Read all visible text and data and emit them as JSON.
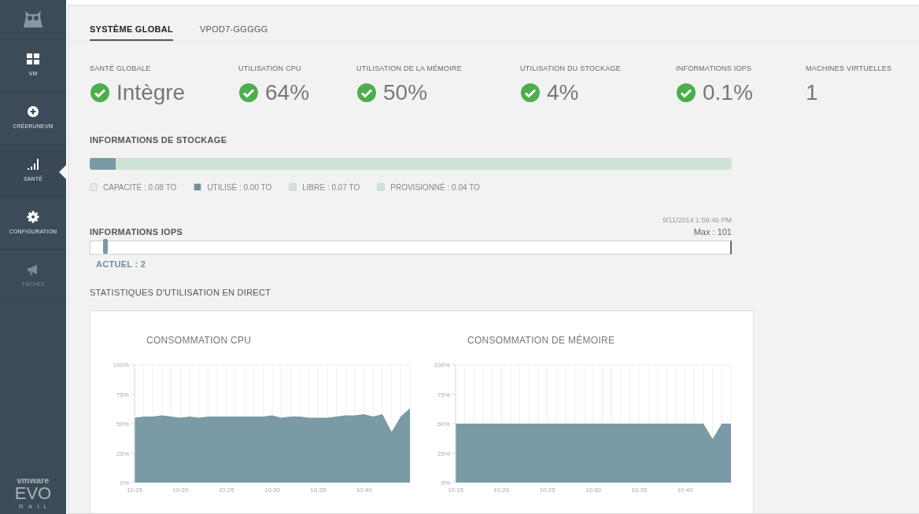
{
  "sidebar": {
    "items": [
      {
        "label": "VM",
        "selected": false,
        "disabled": false
      },
      {
        "label": "CRÉERUNEVM",
        "selected": false,
        "disabled": false
      },
      {
        "label": "SANTÉ",
        "selected": true,
        "disabled": false
      },
      {
        "label": "CONFIGURATION",
        "selected": false,
        "disabled": false
      },
      {
        "label": "TÂCHES",
        "selected": false,
        "disabled": true
      }
    ],
    "logo": {
      "brand": "vmware",
      "product": "EVO",
      "edition": "RAIL"
    }
  },
  "tabs": [
    {
      "label": "SYSTÈME GLOBAL",
      "selected": true
    },
    {
      "label": "VPOD7-GGGGG",
      "selected": false
    }
  ],
  "metrics": [
    {
      "label": "SANTÉ GLOBALE",
      "value": "Intègre",
      "kind": "status"
    },
    {
      "label": "UTILISATION CPU",
      "value": "64%",
      "kind": "status"
    },
    {
      "label": "UTILISATION DE LA MÉMOIRE",
      "value": "50%",
      "kind": "status"
    },
    {
      "label": "UTILISATION DU STOCKAGE",
      "value": "4%",
      "kind": "status"
    },
    {
      "label": "INFORMATIONS IOPS",
      "value": "0.1%",
      "kind": "status"
    },
    {
      "label": "MACHINES VIRTUELLES",
      "value": "1",
      "kind": "count"
    }
  ],
  "storage": {
    "title": "INFORMATIONS DE STOCKAGE",
    "level": 0.04,
    "legend": [
      {
        "label": "CAPACITÉ : 0.08 TO",
        "color": "#e8e8e8"
      },
      {
        "label": "UTILISÉ : 0.00 TO",
        "color": "#6f8f9c"
      },
      {
        "label": "LIBRE : 0.07 TO",
        "color": "#cfe4d6"
      },
      {
        "label": "PROVISIONNÉ : 0.04 TO",
        "color": "#cfe4d6"
      }
    ]
  },
  "iops": {
    "title": "INFORMATIONS IOPS",
    "timestamp": "9/11/2014 1:59:46 PM",
    "max": "Max : 101",
    "current": "ACTUEL : 2",
    "level": 0.02
  },
  "live_stats": {
    "title": "STATISTIQUES D'UTILISATION EN DIRECT",
    "charts": [
      {
        "chart_data": {
          "type": "area",
          "title": "CONSOMMATION CPU",
          "grid": true,
          "categories": [
            "10:15",
            null,
            null,
            null,
            null,
            "10:20",
            null,
            null,
            null,
            null,
            "10:25",
            null,
            null,
            null,
            null,
            "10:30",
            null,
            null,
            null,
            null,
            "10:35",
            null,
            null,
            null,
            null,
            "10:40",
            null,
            null,
            null,
            null,
            null
          ],
          "ylim": [
            0,
            100
          ],
          "yticks": [
            {
              "value": 0,
              "label": "0%"
            },
            {
              "value": 25,
              "label": "25%"
            },
            {
              "value": 50,
              "label": "50%"
            },
            {
              "value": 75,
              "label": "75%"
            },
            {
              "value": 100,
              "label": "100%"
            }
          ],
          "series": [
            {
              "color": "#7a9aa5",
              "values": [
                55,
                56,
                56,
                57,
                56,
                55,
                56,
                55,
                56,
                56,
                56,
                56,
                56,
                56,
                56,
                57,
                55,
                56,
                56,
                55,
                55,
                55,
                56,
                57,
                57,
                58,
                56,
                58,
                43,
                56,
                63
              ]
            }
          ]
        }
      },
      {
        "chart_data": {
          "type": "area",
          "title": "CONSOMMATION DE MÉMOIRE",
          "grid": true,
          "categories": [
            "10:15",
            null,
            null,
            null,
            null,
            "10:20",
            null,
            null,
            null,
            null,
            "10:25",
            null,
            null,
            null,
            null,
            "10:30",
            null,
            null,
            null,
            null,
            "10:35",
            null,
            null,
            null,
            null,
            "10:40",
            null,
            null,
            null,
            null,
            null
          ],
          "ylim": [
            0,
            100
          ],
          "yticks": [
            {
              "value": 0,
              "label": "0%"
            },
            {
              "value": 25,
              "label": "25%"
            },
            {
              "value": 50,
              "label": "50%"
            },
            {
              "value": 75,
              "label": "75%"
            },
            {
              "value": 100,
              "label": "100%"
            }
          ],
          "series": [
            {
              "color": "#7a9aa5",
              "values": [
                50,
                50,
                50,
                50,
                50,
                50,
                50,
                50,
                50,
                50,
                50,
                50,
                50,
                50,
                50,
                50,
                50,
                50,
                50,
                50,
                50,
                50,
                50,
                50,
                50,
                50,
                50,
                50,
                37,
                50,
                50
              ]
            }
          ]
        }
      }
    ]
  }
}
